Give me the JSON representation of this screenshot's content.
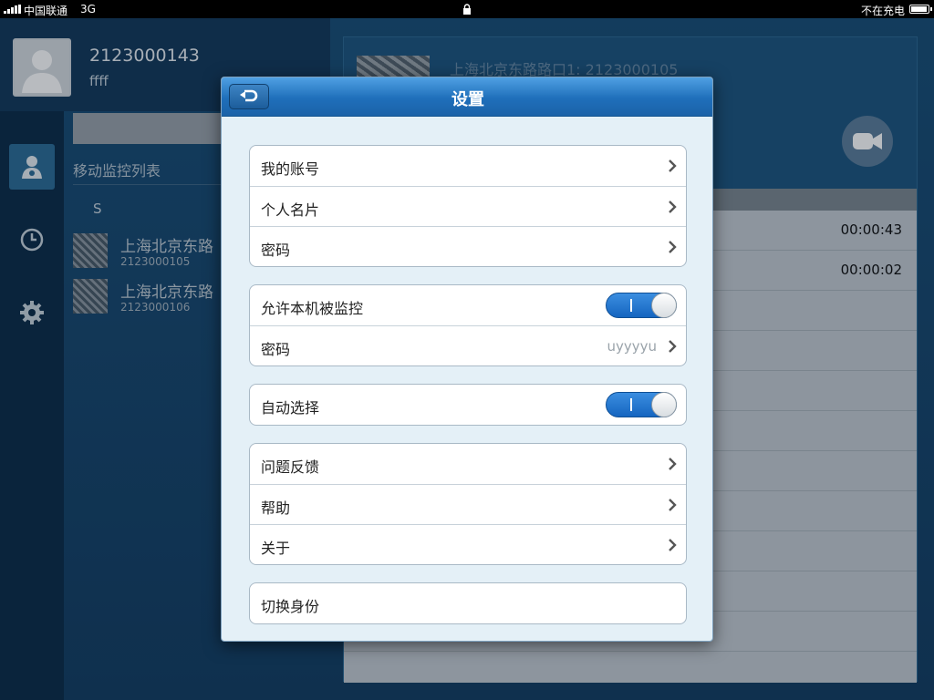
{
  "statusbar": {
    "carrier": "中国联通",
    "network": "3G",
    "charging": "不在充电"
  },
  "background": {
    "user": {
      "id": "2123000143",
      "name": "ffff"
    },
    "list_title": "移动监控列表",
    "section_letter": "S",
    "contacts": [
      {
        "title": "上海北京东路",
        "id": "2123000105"
      },
      {
        "title": "上海北京东路",
        "id": "2123000106"
      }
    ],
    "detail_title": "上海北京东路路口1: 2123000105",
    "times": [
      "00:00:43",
      "00:00:02"
    ]
  },
  "settings": {
    "title": "设置",
    "account": {
      "label": "我的账号"
    },
    "card": {
      "label": "个人名片"
    },
    "password": {
      "label": "密码"
    },
    "allow_monitor": {
      "label": "允许本机被监控",
      "enabled": true
    },
    "monitor_password": {
      "label": "密码",
      "value": "uyyyyu"
    },
    "auto_select": {
      "label": "自动选择",
      "enabled": true
    },
    "feedback": {
      "label": "问题反馈"
    },
    "help": {
      "label": "帮助"
    },
    "about": {
      "label": "关于"
    },
    "switch_identity": {
      "label": "切换身份"
    }
  }
}
